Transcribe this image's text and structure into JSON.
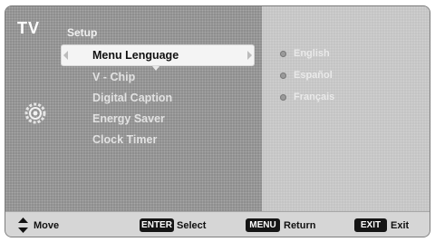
{
  "header": {
    "brand": "TV",
    "section": "Setup"
  },
  "menu": {
    "items": [
      {
        "label": "Menu Lenguage",
        "selected": true
      },
      {
        "label": "V - Chip"
      },
      {
        "label": "Digital Caption"
      },
      {
        "label": "Energy Saver"
      },
      {
        "label": "Clock Timer"
      }
    ]
  },
  "options": [
    {
      "label": "English"
    },
    {
      "label": "Español"
    },
    {
      "label": "Français"
    }
  ],
  "footer": {
    "move": "Move",
    "enter_key": "ENTER",
    "select": "Select",
    "menu_key": "MENU",
    "return": "Return",
    "exit_key": "EXIT",
    "exit": "Exit"
  },
  "icons": [
    "up-down-arrows-icon",
    "gear-icon",
    "left-arrow-icon",
    "right-arrow-icon",
    "down-arrow-icon"
  ]
}
